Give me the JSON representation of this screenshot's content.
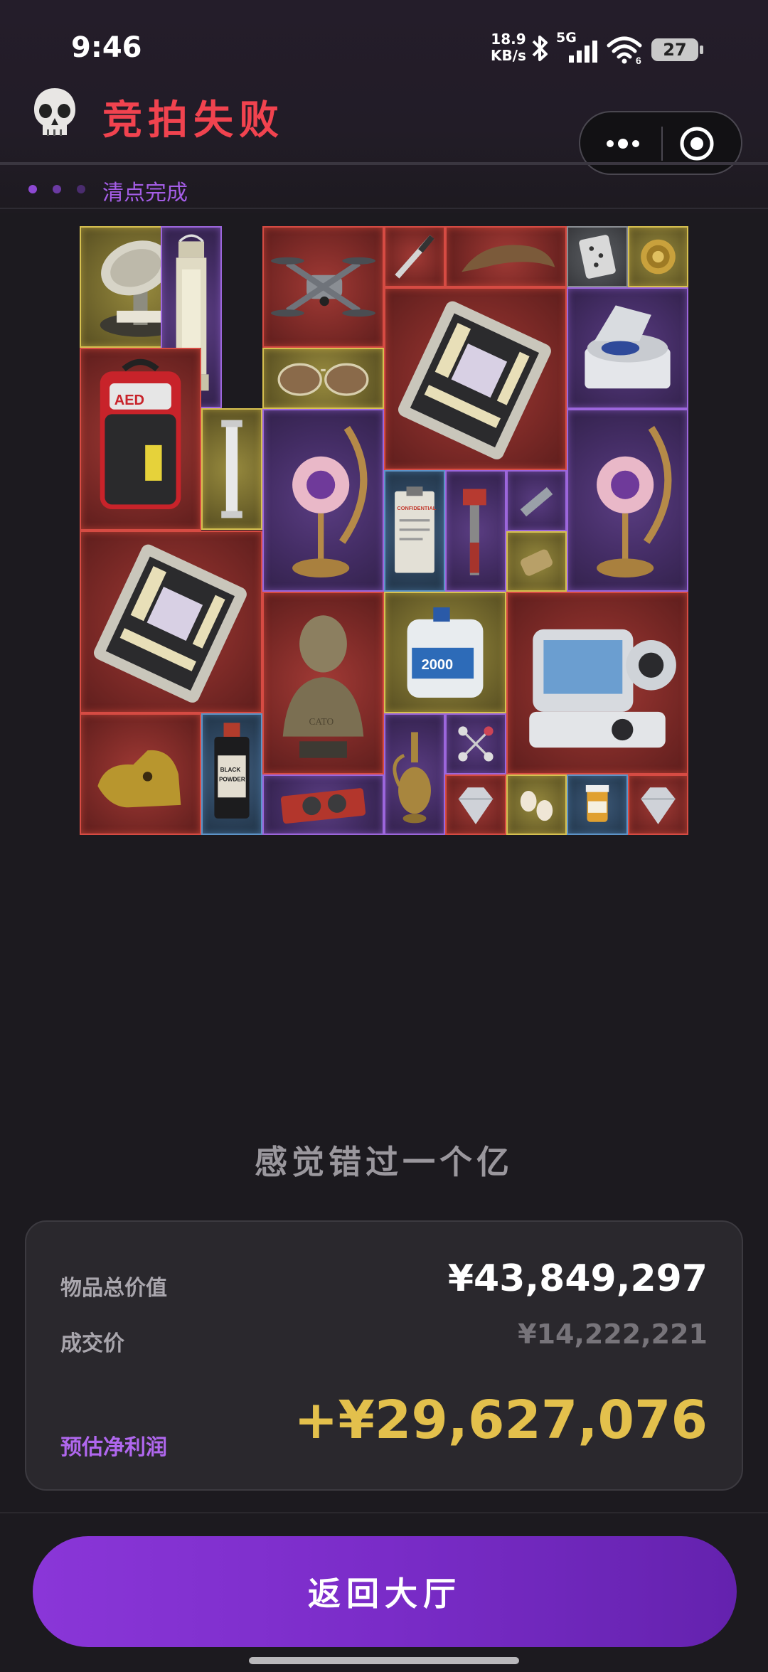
{
  "status_bar": {
    "time": "9:46",
    "net_speed_value": "18.9",
    "net_speed_unit": "KB/s",
    "network_type": "5G",
    "wifi_badge": "6",
    "battery": "27"
  },
  "header": {
    "title": "竞拍失败",
    "icon": "skull-icon"
  },
  "progress": {
    "label": "清点完成",
    "accent": "#a45de6"
  },
  "loot_grid": {
    "items": [
      {
        "name": "radar-dish-device",
        "rarity": "gold"
      },
      {
        "name": "lantern",
        "rarity": "purple"
      },
      {
        "name": "drone",
        "rarity": "red"
      },
      {
        "name": "pen",
        "rarity": "red"
      },
      {
        "name": "horn-claw",
        "rarity": "red"
      },
      {
        "name": "playing-card",
        "rarity": "gray"
      },
      {
        "name": "gold-coin",
        "rarity": "gold"
      },
      {
        "name": "circuit-board",
        "rarity": "red"
      },
      {
        "name": "centrifuge",
        "rarity": "purple"
      },
      {
        "name": "aviator-sunglasses",
        "rarity": "gold"
      },
      {
        "name": "aed-defibrillator",
        "rarity": "red"
      },
      {
        "name": "glass-tube",
        "rarity": "gold"
      },
      {
        "name": "moon-lamp",
        "rarity": "purple"
      },
      {
        "name": "confidential-clipboard",
        "rarity": "blue"
      },
      {
        "name": "pipe-wrench",
        "rarity": "purple"
      },
      {
        "name": "metal-bar",
        "rarity": "purple"
      },
      {
        "name": "moon-lamp",
        "rarity": "purple"
      },
      {
        "name": "brass-cylinder",
        "rarity": "gold"
      },
      {
        "name": "circuit-board",
        "rarity": "red"
      },
      {
        "name": "cato-bust",
        "rarity": "red"
      },
      {
        "name": "jerrycan",
        "rarity": "gold"
      },
      {
        "name": "medical-ventilator",
        "rarity": "red"
      },
      {
        "name": "golden-animal-head",
        "rarity": "red"
      },
      {
        "name": "black-powder-bottle",
        "rarity": "blue"
      },
      {
        "name": "graphics-card",
        "rarity": "purple"
      },
      {
        "name": "ornate-vase",
        "rarity": "purple"
      },
      {
        "name": "molecule-model",
        "rarity": "purple"
      },
      {
        "name": "diamond",
        "rarity": "red"
      },
      {
        "name": "pearls",
        "rarity": "gold"
      },
      {
        "name": "pill-bottle",
        "rarity": "blue"
      },
      {
        "name": "diamond",
        "rarity": "red"
      }
    ],
    "texts": {
      "aed": "AED",
      "clipboard": "CONFIDENTIAL",
      "powder_line1": "BLACK",
      "powder_line2": "POWDER",
      "bust": "CATO",
      "jerrycan": "2000"
    }
  },
  "tagline": "感觉错过一个亿",
  "summary": {
    "total_label": "物品总价值",
    "total_value": "¥43,849,297",
    "deal_label": "成交价",
    "deal_value": "¥14,222,221",
    "profit_label": "预估净利润",
    "profit_value": "+¥29,627,076",
    "profit_color": "#e3c04c"
  },
  "actions": {
    "back_label": "返回大厅",
    "button_color": "#7a2cc8"
  }
}
